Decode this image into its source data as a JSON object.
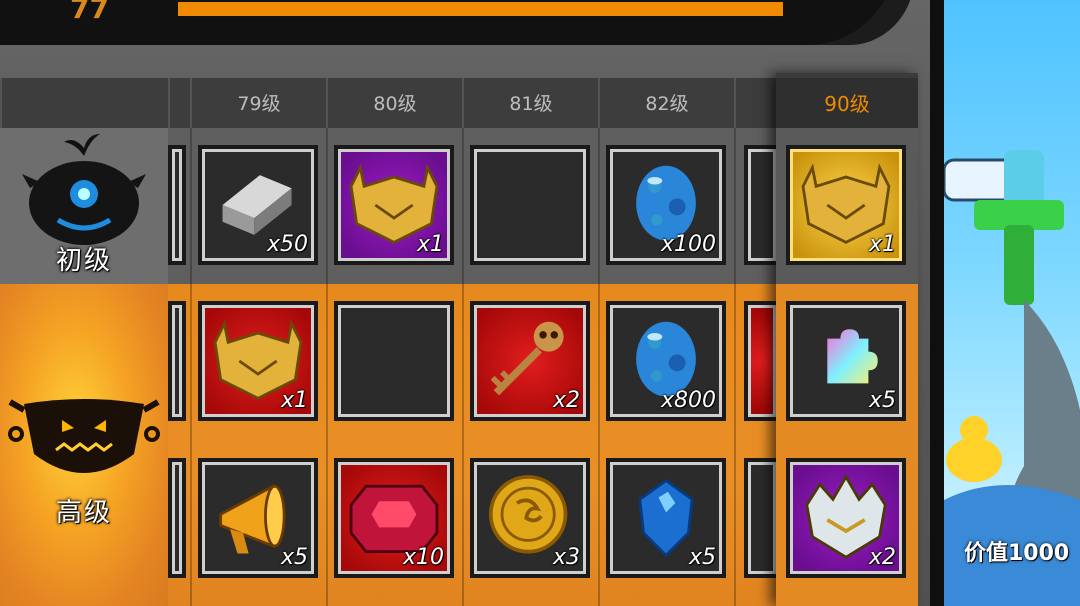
{
  "top": {
    "level_value": "77",
    "progress_fraction": 1.0
  },
  "levels": [
    "79级",
    "80级",
    "81级",
    "82级"
  ],
  "highlight_level": "90级",
  "tiers": [
    {
      "label": "初级"
    },
    {
      "label": "高级"
    }
  ],
  "rows": {
    "basic": [
      {
        "icon": "silver-ingot-icon",
        "qty": "x50",
        "style": "dark"
      },
      {
        "icon": "golden-helmet-icon",
        "qty": "x1",
        "style": "purple"
      },
      {
        "icon": "empty-slot",
        "qty": "",
        "style": "empty"
      },
      {
        "icon": "blue-egg-icon",
        "qty": "x100",
        "style": "dark"
      }
    ],
    "advanced_1": [
      {
        "icon": "golden-helmet-icon",
        "qty": "x1",
        "style": "red"
      },
      {
        "icon": "empty-slot",
        "qty": "",
        "style": "empty"
      },
      {
        "icon": "skull-key-icon",
        "qty": "x2",
        "style": "red"
      },
      {
        "icon": "blue-egg-icon",
        "qty": "x800",
        "style": "dark"
      }
    ],
    "advanced_2": [
      {
        "icon": "megaphone-icon",
        "qty": "x5",
        "style": "dark"
      },
      {
        "icon": "red-gem-icon",
        "qty": "x10",
        "style": "red"
      },
      {
        "icon": "dragon-coin-icon",
        "qty": "x3",
        "style": "dark"
      },
      {
        "icon": "blue-crystal-icon",
        "qty": "x5",
        "style": "dark"
      }
    ]
  },
  "col90": [
    {
      "icon": "golden-helmet-icon",
      "qty": "x1",
      "style": "gold"
    },
    {
      "icon": "rainbow-puzzle-icon",
      "qty": "x5",
      "style": "dark"
    },
    {
      "icon": "silver-crown-helmet-icon",
      "qty": "x2",
      "style": "purple"
    }
  ],
  "promo": {
    "text": "价值1000"
  },
  "colors": {
    "accent": "#f08a00",
    "advanced_bg": "#e58a22"
  }
}
